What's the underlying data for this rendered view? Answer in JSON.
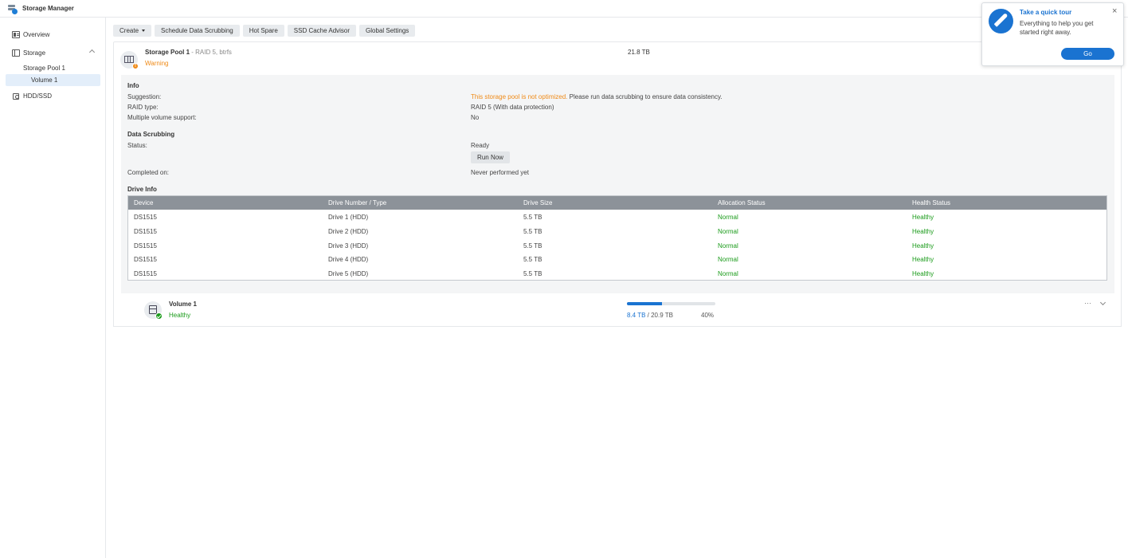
{
  "app": {
    "title": "Storage Manager"
  },
  "sidebar": {
    "overview": "Overview",
    "storage": "Storage",
    "pool": "Storage Pool 1",
    "volume": "Volume 1",
    "hdd": "HDD/SSD"
  },
  "toolbar": {
    "create": "Create",
    "scrub": "Schedule Data Scrubbing",
    "hotspare": "Hot Spare",
    "ssd": "SSD Cache Advisor",
    "global": "Global Settings"
  },
  "pool": {
    "name": "Storage Pool 1",
    "meta": " - RAID 5, btrfs",
    "status": "Warning",
    "size": "21.8 TB",
    "warn_glyph": "!"
  },
  "info": {
    "title": "Info",
    "suggestion_label": "Suggestion:",
    "suggestion_warn": "This storage pool is not optimized.",
    "suggestion_rest": " Please run data scrubbing to ensure data consistency.",
    "raid_label": "RAID type:",
    "raid_value": "RAID 5 (With data protection)",
    "multi_label": "Multiple volume support:",
    "multi_value": "No"
  },
  "scrubbing": {
    "title": "Data Scrubbing",
    "status_label": "Status:",
    "status_value": "Ready",
    "run_button": "Run Now",
    "completed_label": "Completed on:",
    "completed_value": "Never performed yet"
  },
  "drives": {
    "title": "Drive Info",
    "columns": [
      "Device",
      "Drive Number / Type",
      "Drive Size",
      "Allocation Status",
      "Health Status"
    ],
    "rows": [
      [
        "DS1515",
        "Drive 1 (HDD)",
        "5.5 TB",
        "Normal",
        "Healthy"
      ],
      [
        "DS1515",
        "Drive 2 (HDD)",
        "5.5 TB",
        "Normal",
        "Healthy"
      ],
      [
        "DS1515",
        "Drive 3 (HDD)",
        "5.5 TB",
        "Normal",
        "Healthy"
      ],
      [
        "DS1515",
        "Drive 4 (HDD)",
        "5.5 TB",
        "Normal",
        "Healthy"
      ],
      [
        "DS1515",
        "Drive 5 (HDD)",
        "5.5 TB",
        "Normal",
        "Healthy"
      ]
    ]
  },
  "volume": {
    "name": "Volume 1",
    "status": "Healthy",
    "used": "8.4 TB",
    "separator": " / ",
    "total": "20.9 TB",
    "percent_label": "40%",
    "usage_fraction": 0.4,
    "more": "···"
  },
  "tour": {
    "title": "Take a quick tour",
    "text": "Everything to help you get started right away.",
    "go": "Go",
    "close": "×"
  },
  "colors": {
    "accent": "#1a73d1",
    "warning": "#ef8a17",
    "healthy": "#1a9b1a"
  }
}
